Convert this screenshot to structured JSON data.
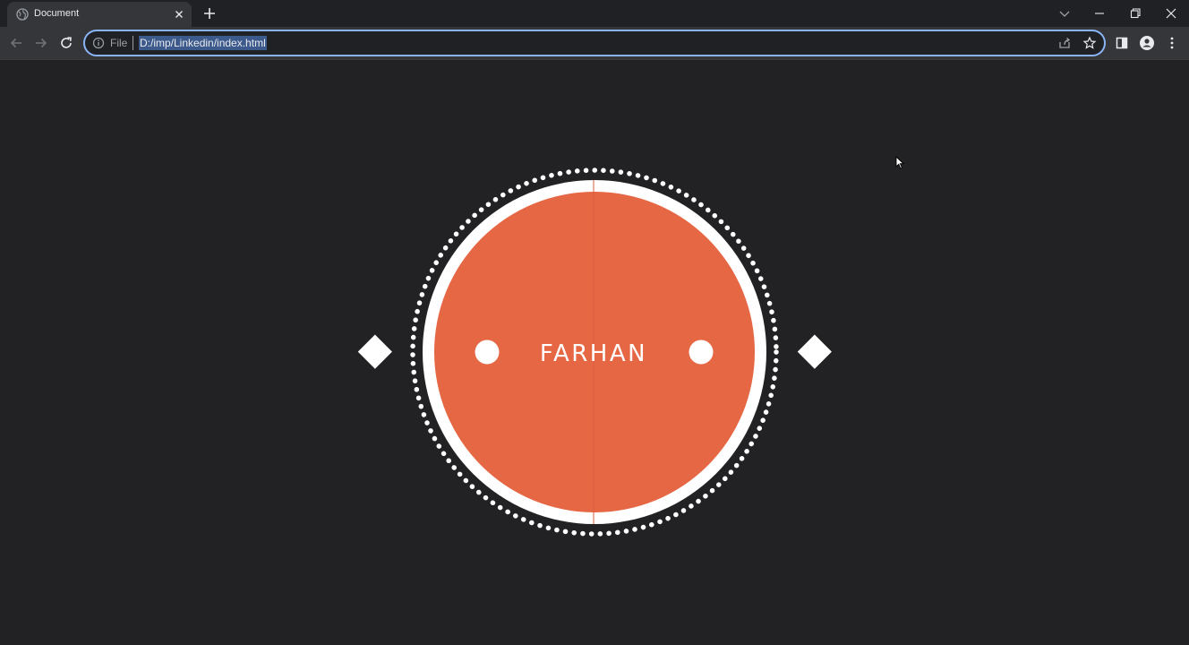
{
  "browser": {
    "tab": {
      "title": "Document",
      "favicon": "globe-icon"
    },
    "omnibox": {
      "scheme": "File",
      "url": "D:/imp/Linkedin/index.html"
    },
    "icons": [
      "back-icon",
      "forward-icon",
      "reload-icon",
      "share-icon",
      "star-icon",
      "side-panel-icon",
      "profile-icon",
      "menu-icon",
      "tab-search-icon",
      "minimize-icon",
      "restore-icon",
      "close-icon"
    ]
  },
  "page": {
    "name": "FARHAN",
    "colors": {
      "background": "#222224",
      "accent": "#e66744",
      "ring": "#ffffff"
    }
  }
}
